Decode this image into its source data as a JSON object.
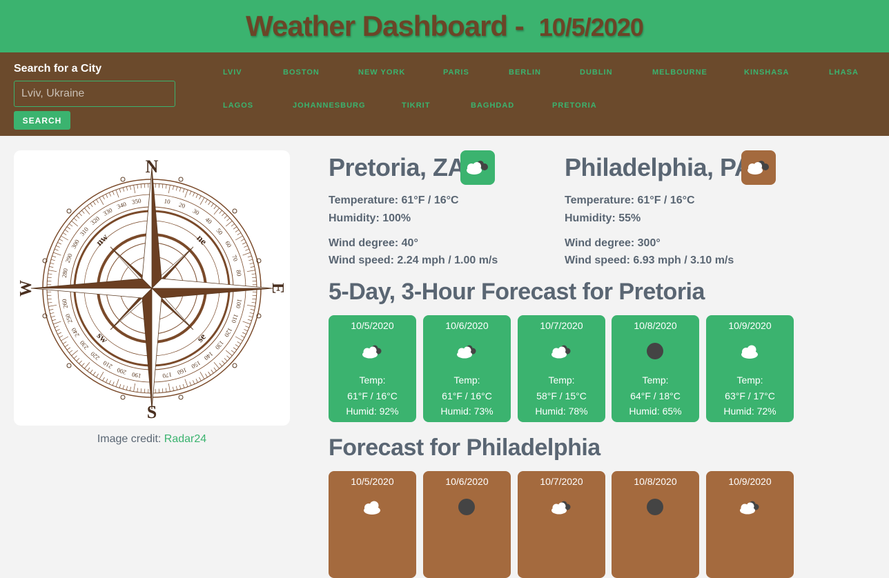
{
  "header": {
    "title": "Weather Dashboard -",
    "date": "10/5/2020"
  },
  "search": {
    "label": "Search for a City",
    "placeholder": "Lviv, Ukraine",
    "button_label": "SEARCH"
  },
  "cities": [
    "LVIV",
    "BOSTON",
    "NEW YORK",
    "PARIS",
    "BERLIN",
    "DUBLIN",
    "MELBOURNE",
    "KINSHASA",
    "LHASA",
    "LAGOS",
    "JOHANNESBURG",
    "TIKRIT",
    "BAGHDAD",
    "PRETORIA"
  ],
  "compass": {
    "credit_prefix": "Image credit:",
    "credit_link": "Radar24",
    "letters": {
      "n": "N",
      "s": "S",
      "e": "E",
      "w": "W",
      "ne": "ne",
      "nw": "nw",
      "se": "se",
      "sw": "sw"
    }
  },
  "current": [
    {
      "city": "Pretoria, ZA",
      "icon": "cloudy-icon",
      "temperature": "Temperature: 61°F / 16°C",
      "humidity": "Humidity: 100%",
      "wind_degree": "Wind degree: 40°",
      "wind_speed": "Wind speed: 2.24 mph / 1.00 m/s",
      "accent": "#3bb36f"
    },
    {
      "city": "Philadelphia, PA",
      "icon": "cloudy-icon",
      "temperature": "Temperature: 61°F / 16°C",
      "humidity": "Humidity: 55%",
      "wind_degree": "Wind degree: 300°",
      "wind_speed": "Wind speed: 6.93 mph / 3.10 m/s",
      "accent": "#a46a3e"
    }
  ],
  "forecast_pretoria": {
    "title": "5-Day, 3-Hour Forecast for Pretoria",
    "days": [
      {
        "date": "10/5/2020",
        "icon": "cloudy-icon",
        "temp_label": "Temp:",
        "temp": "61°F / 16°C",
        "humid": "Humid: 92%"
      },
      {
        "date": "10/6/2020",
        "icon": "cloudy-icon",
        "temp_label": "Temp:",
        "temp": "61°F / 16°C",
        "humid": "Humid: 73%"
      },
      {
        "date": "10/7/2020",
        "icon": "cloudy-icon",
        "temp_label": "Temp:",
        "temp": "58°F / 15°C",
        "humid": "Humid: 78%"
      },
      {
        "date": "10/8/2020",
        "icon": "dark-circle-icon",
        "temp_label": "Temp:",
        "temp": "64°F / 18°C",
        "humid": "Humid: 65%"
      },
      {
        "date": "10/9/2020",
        "icon": "cloud-icon",
        "temp_label": "Temp:",
        "temp": "63°F / 17°C",
        "humid": "Humid: 72%"
      }
    ]
  },
  "forecast_philadelphia": {
    "title": "Forecast for Philadelphia",
    "days": [
      {
        "date": "10/5/2020",
        "icon": "cloud-icon"
      },
      {
        "date": "10/6/2020",
        "icon": "dark-circle-icon"
      },
      {
        "date": "10/7/2020",
        "icon": "cloudy-icon"
      },
      {
        "date": "10/8/2020",
        "icon": "dark-circle-icon"
      },
      {
        "date": "10/9/2020",
        "icon": "cloudy-icon"
      }
    ]
  },
  "colors": {
    "green": "#3bb36f",
    "brown": "#6b4a2c",
    "light_brown": "#a46a3e",
    "text": "#5a6673"
  }
}
